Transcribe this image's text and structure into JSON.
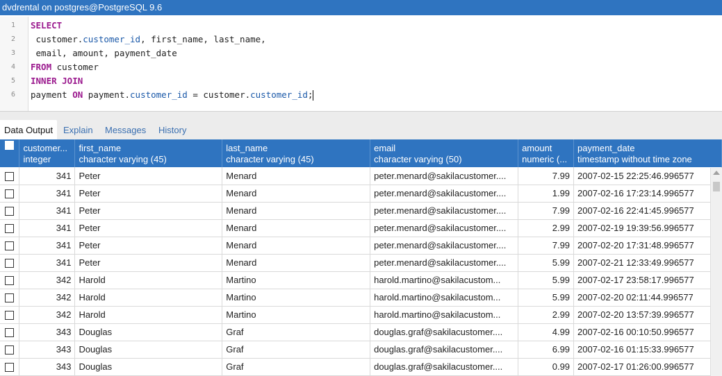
{
  "window": {
    "title": "dvdrental on postgres@PostgreSQL 9.6"
  },
  "editor": {
    "line_numbers": [
      "1",
      "2",
      "3",
      "4",
      "5",
      "6"
    ],
    "lines": [
      [
        {
          "t": "SELECT",
          "c": "kw"
        }
      ],
      [
        {
          "t": " customer.",
          "c": "id"
        },
        {
          "t": "customer_id",
          "c": "prop"
        },
        {
          "t": ", first_name, last_name,",
          "c": "id"
        }
      ],
      [
        {
          "t": " email, amount, payment_date",
          "c": "id"
        }
      ],
      [
        {
          "t": "FROM",
          "c": "kw"
        },
        {
          "t": " customer",
          "c": "id"
        }
      ],
      [
        {
          "t": "INNER JOIN",
          "c": "kw"
        }
      ],
      [
        {
          "t": "payment ",
          "c": "id"
        },
        {
          "t": "ON",
          "c": "kw"
        },
        {
          "t": " payment.",
          "c": "id"
        },
        {
          "t": "customer_id",
          "c": "prop"
        },
        {
          "t": " = customer.",
          "c": "id"
        },
        {
          "t": "customer_id",
          "c": "prop"
        },
        {
          "t": ";",
          "c": "id"
        }
      ]
    ]
  },
  "tabs": [
    {
      "label": "Data Output",
      "active": true
    },
    {
      "label": "Explain",
      "active": false
    },
    {
      "label": "Messages",
      "active": false
    },
    {
      "label": "History",
      "active": false
    }
  ],
  "grid": {
    "columns": [
      {
        "name": "customer...",
        "type": "integer"
      },
      {
        "name": "first_name",
        "type": "character varying (45)"
      },
      {
        "name": "last_name",
        "type": "character varying (45)"
      },
      {
        "name": "email",
        "type": "character varying (50)"
      },
      {
        "name": "amount",
        "type": "numeric (..."
      },
      {
        "name": "payment_date",
        "type": "timestamp without time zone"
      }
    ],
    "rows": [
      [
        "341",
        "Peter",
        "Menard",
        "peter.menard@sakilacustomer....",
        "7.99",
        "2007-02-15 22:25:46.996577"
      ],
      [
        "341",
        "Peter",
        "Menard",
        "peter.menard@sakilacustomer....",
        "1.99",
        "2007-02-16 17:23:14.996577"
      ],
      [
        "341",
        "Peter",
        "Menard",
        "peter.menard@sakilacustomer....",
        "7.99",
        "2007-02-16 22:41:45.996577"
      ],
      [
        "341",
        "Peter",
        "Menard",
        "peter.menard@sakilacustomer....",
        "2.99",
        "2007-02-19 19:39:56.996577"
      ],
      [
        "341",
        "Peter",
        "Menard",
        "peter.menard@sakilacustomer....",
        "7.99",
        "2007-02-20 17:31:48.996577"
      ],
      [
        "341",
        "Peter",
        "Menard",
        "peter.menard@sakilacustomer....",
        "5.99",
        "2007-02-21 12:33:49.996577"
      ],
      [
        "342",
        "Harold",
        "Martino",
        "harold.martino@sakilacustom...",
        "5.99",
        "2007-02-17 23:58:17.996577"
      ],
      [
        "342",
        "Harold",
        "Martino",
        "harold.martino@sakilacustom...",
        "5.99",
        "2007-02-20 02:11:44.996577"
      ],
      [
        "342",
        "Harold",
        "Martino",
        "harold.martino@sakilacustom...",
        "2.99",
        "2007-02-20 13:57:39.996577"
      ],
      [
        "343",
        "Douglas",
        "Graf",
        "douglas.graf@sakilacustomer....",
        "4.99",
        "2007-02-16 00:10:50.996577"
      ],
      [
        "343",
        "Douglas",
        "Graf",
        "douglas.graf@sakilacustomer....",
        "6.99",
        "2007-02-16 01:15:33.996577"
      ],
      [
        "343",
        "Douglas",
        "Graf",
        "douglas.graf@sakilacustomer....",
        "0.99",
        "2007-02-17 01:26:00.996577"
      ]
    ]
  }
}
